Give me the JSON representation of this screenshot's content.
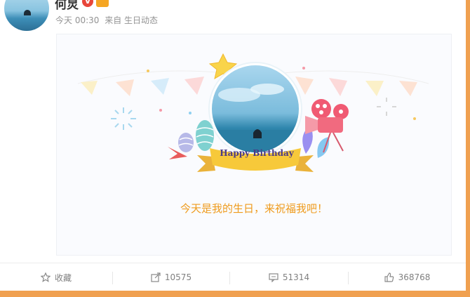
{
  "post": {
    "username": "何炅",
    "vip_badge": "V",
    "timestamp": "今天 00:30",
    "source": "来自 生日动态"
  },
  "card": {
    "banner_text": "Happy Birthday",
    "greeting": "今天是我的生日，来祝福我吧！"
  },
  "actions": {
    "favorite": {
      "label": "收藏",
      "icon": "star-icon"
    },
    "repost": {
      "count": "10575",
      "icon": "share-icon"
    },
    "comment": {
      "count": "51314",
      "icon": "comment-icon"
    },
    "like": {
      "count": "368768",
      "icon": "thumbs-up-icon"
    }
  },
  "colors": {
    "accent_orange": "#ef9b1d",
    "frame": "#f0a050",
    "banner_yellow": "#f7c93a"
  }
}
